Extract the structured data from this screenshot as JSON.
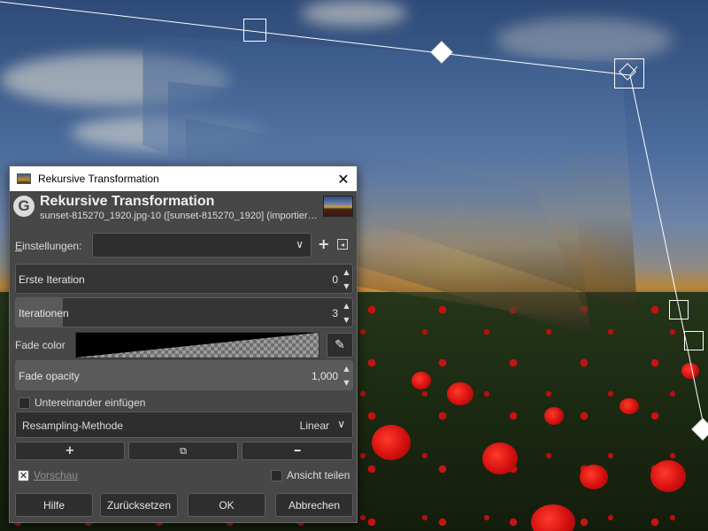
{
  "window": {
    "title": "Rekursive Transformation",
    "close_glyph": "✕"
  },
  "header": {
    "logo_glyph": "G",
    "title": "Rekursive Transformation",
    "subtitle": "sunset-815270_1920.jpg-10 ([sunset-815270_1920] (importier…"
  },
  "settings": {
    "label": "Einstellungen:",
    "label_mnemonic": "E",
    "label_rest": "instellungen:",
    "value": "",
    "add_glyph": "+",
    "menu_glyph": "◂"
  },
  "first_iteration": {
    "label": "Erste Iteration",
    "value": "0",
    "fill_fraction": 0.0
  },
  "iterations": {
    "label": "Iterationen",
    "value": "3",
    "fill_fraction": 0.14
  },
  "fade_color": {
    "label": "Fade color",
    "picker_icon": "color-picker-icon",
    "picker_glyph": "✎"
  },
  "fade_opacity": {
    "label": "Fade opacity",
    "value": "1,000",
    "fill_fraction": 1.0
  },
  "stack": {
    "label": "Untereinander einfügen",
    "checked": false
  },
  "resampling": {
    "label": "Resampling-Methode",
    "value": "Linear"
  },
  "transform_buttons": {
    "add_glyph": "+",
    "duplicate_glyph": "⧉",
    "remove_glyph": "━"
  },
  "preview": {
    "label": "Vorschau",
    "checked": true,
    "check_glyph": "✕"
  },
  "split_view": {
    "label": "Ansicht teilen",
    "checked": false
  },
  "buttons": {
    "help": "Hilfe",
    "reset": "Zurücksetzen",
    "ok": "OK",
    "cancel": "Abbrechen"
  },
  "colors": {
    "dialog_bg": "#474747",
    "field_bg": "#2e2e2e",
    "text": "#e6e6e6"
  }
}
